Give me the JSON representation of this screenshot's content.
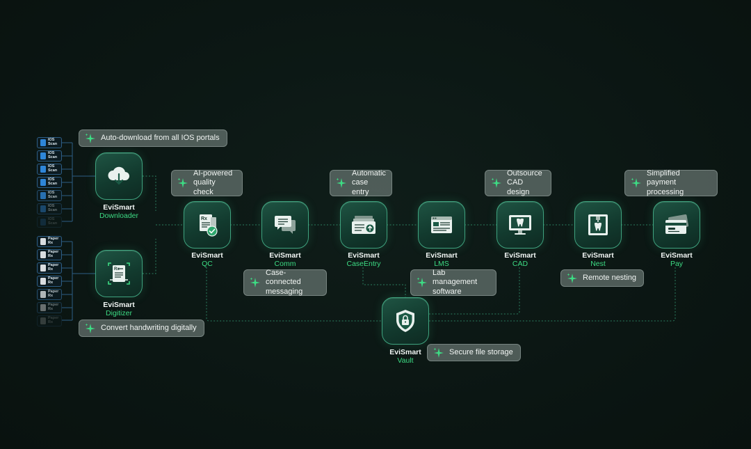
{
  "scan_chips": [
    {
      "label": "IOS\nScan",
      "opacity": 1
    },
    {
      "label": "IOS\nScan",
      "opacity": 1
    },
    {
      "label": "IOS\nScan",
      "opacity": 1
    },
    {
      "label": "IOS\nScan",
      "opacity": 1
    },
    {
      "label": "IOS\nScan",
      "opacity": 0.8
    },
    {
      "label": "IOS\nScan",
      "opacity": 0.45
    },
    {
      "label": "IOS\nScan",
      "opacity": 0.2
    }
  ],
  "paper_chips": [
    {
      "label": "Paper\nRx",
      "opacity": 1
    },
    {
      "label": "Paper\nRx",
      "opacity": 1
    },
    {
      "label": "Paper\nRx",
      "opacity": 1
    },
    {
      "label": "Paper\nRx",
      "opacity": 1
    },
    {
      "label": "Paper\nRx",
      "opacity": 0.8
    },
    {
      "label": "Paper\nRx",
      "opacity": 0.45
    },
    {
      "label": "Paper\nRx",
      "opacity": 0.2
    }
  ],
  "nodes": {
    "downloader": {
      "brand": "EviSmart",
      "product": "Downloader",
      "icon": "cloud-download-icon"
    },
    "digitizer": {
      "brand": "EviSmart",
      "product": "Digitizer",
      "icon": "document-scan-icon"
    },
    "qc": {
      "brand": "EviSmart",
      "product": "QC",
      "icon": "rx-check-icon"
    },
    "comm": {
      "brand": "EviSmart",
      "product": "Comm",
      "icon": "chat-bubbles-icon"
    },
    "caseentry": {
      "brand": "EviSmart",
      "product": "CaseEntry",
      "icon": "case-upload-icon"
    },
    "lms": {
      "brand": "EviSmart",
      "product": "LMS",
      "icon": "browser-window-icon"
    },
    "cad": {
      "brand": "EviSmart",
      "product": "CAD",
      "icon": "tooth-monitor-icon"
    },
    "nest": {
      "brand": "EviSmart",
      "product": "Nest",
      "icon": "tooth-mill-icon"
    },
    "pay": {
      "brand": "EviSmart",
      "product": "Pay",
      "icon": "credit-card-icon"
    },
    "vault": {
      "brand": "EviSmart",
      "product": "Vault",
      "icon": "shield-lock-icon"
    }
  },
  "callouts": {
    "downloader": "Auto-download from all IOS portals",
    "digitizer": "Convert handwriting digitally",
    "qc": "AI-powered quality check",
    "comm": "Case-connected messaging",
    "caseentry": "Automatic case entry",
    "lms": "Lab management software",
    "cad": "Outsource CAD design",
    "nest": "Remote nesting",
    "pay": "Simplified payment processing",
    "vault": "Secure file storage"
  },
  "colors": {
    "accent_green": "#3ddc84",
    "node_border": "#3fa37f",
    "chip_border": "#2d5e86",
    "background": "#0b1613"
  }
}
